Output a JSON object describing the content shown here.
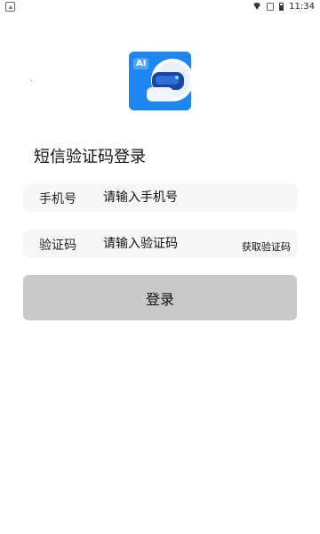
{
  "status_bar": {
    "time": "11:34",
    "icons": [
      "notification-icon",
      "wifi-icon",
      "sim-icon",
      "battery-icon"
    ]
  },
  "logo": {
    "text": "AI",
    "icon": "robot-ai-logo",
    "background_color": "#1e86f0"
  },
  "title": "短信验证码登录",
  "phone_field": {
    "label": "手机号",
    "placeholder": "请输入手机号",
    "value": ""
  },
  "code_field": {
    "label": "验证码",
    "placeholder": "请输入验证码",
    "value": "",
    "get_code_label": "获取验证码"
  },
  "login_button": {
    "label": "登录",
    "background_color": "#c9c9c9"
  }
}
